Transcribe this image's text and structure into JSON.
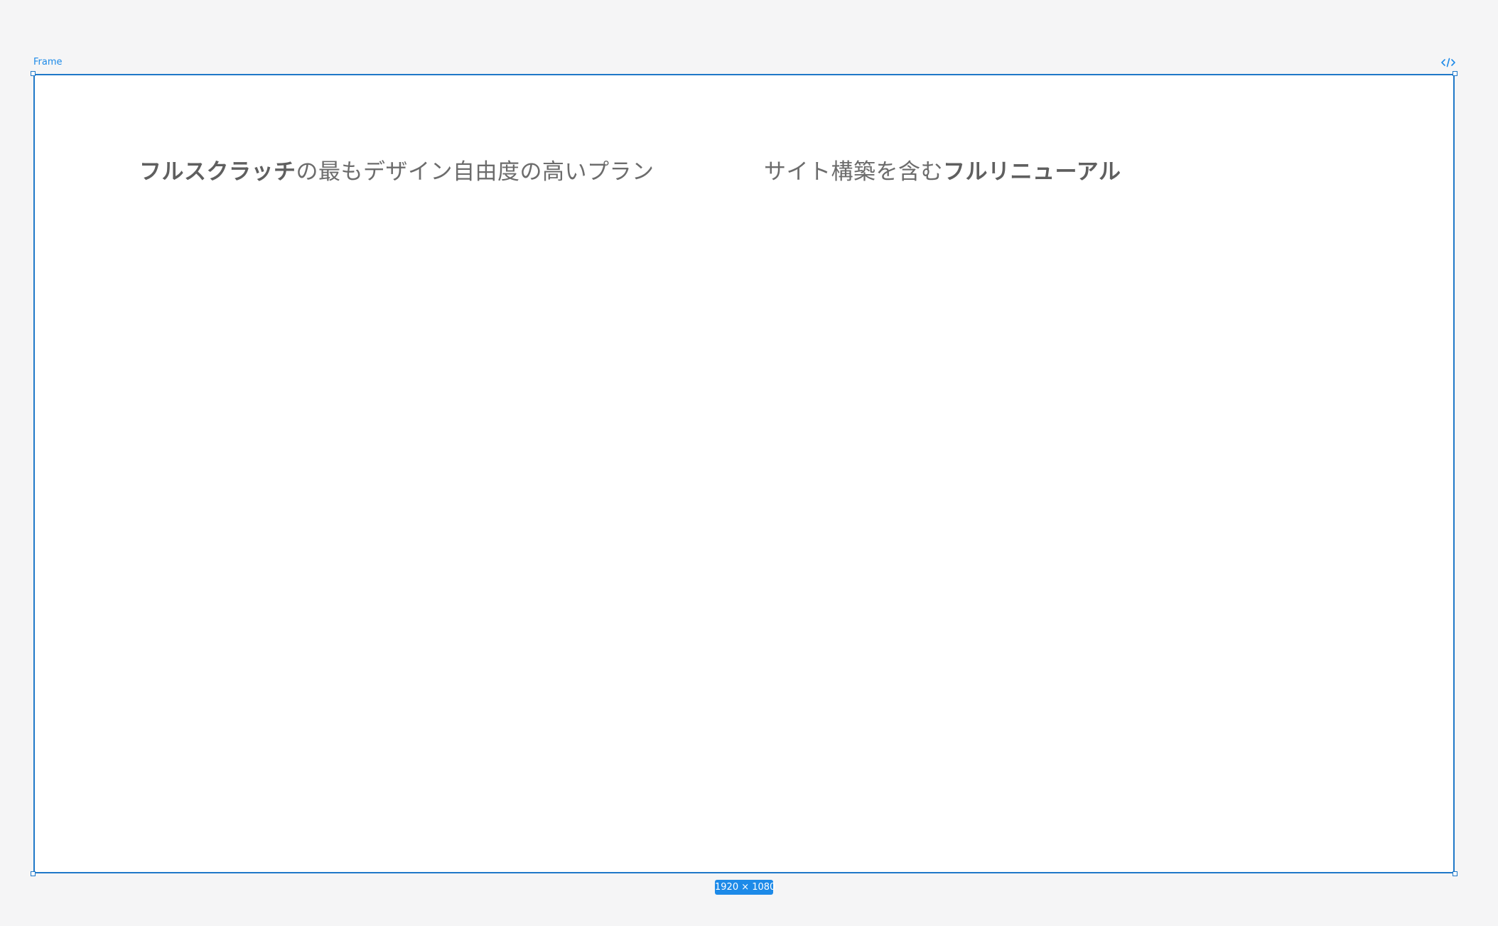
{
  "frame": {
    "label": "Frame",
    "size_label": "1920 × 1080"
  },
  "headings": {
    "left": {
      "bold": "フルスクラッチ",
      "regular": "の最もデザイン自由度の高いプラン"
    },
    "right": {
      "regular": "サイト構築を含む",
      "bold": "フルリニューアル"
    }
  },
  "icons": {
    "code": "code-icon"
  },
  "colors": {
    "accent": "#1d8ae8",
    "frame_border": "#1f78c8",
    "canvas": "#f5f5f6",
    "text": "#6c6c6c"
  }
}
